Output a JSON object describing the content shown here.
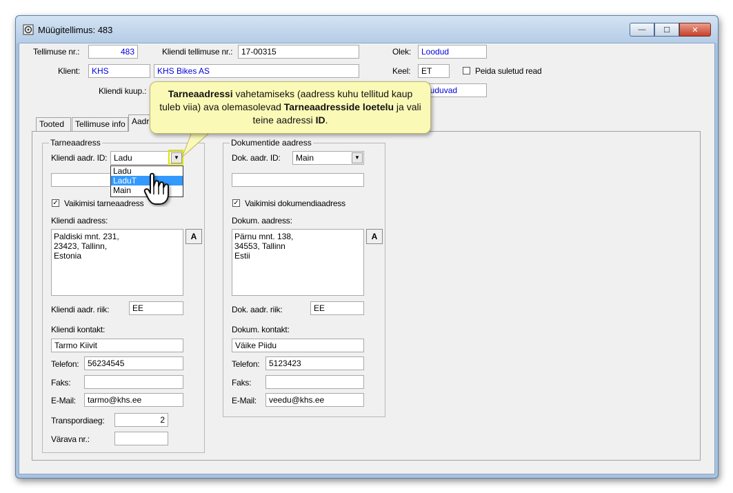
{
  "window": {
    "title": "Müügitellimus: 483"
  },
  "header": {
    "order_nr_label": "Tellimuse nr.:",
    "order_nr": "483",
    "client_order_label": "Kliendi tellimuse nr.:",
    "client_order": "17-00315",
    "state_label": "Olek:",
    "state": "Loodud",
    "client_label": "Klient:",
    "client_code": "KHS",
    "client_name": "KHS Bikes AS",
    "lang_label": "Keel:",
    "lang": "ET",
    "hide_closed_label": "Peida suletud read",
    "client_date_label": "Kliendi kuup.:",
    "status_value": "luduvad"
  },
  "tabs": [
    {
      "label": "Tooted"
    },
    {
      "label": "Tellimuse info"
    },
    {
      "label": "Aadr"
    }
  ],
  "tooltip": {
    "p1_bold": "Tarneaadressi",
    "p2": " vahetamiseks (aadress kuhu tellitud kaup tuleb viia) ava olemasolevad ",
    "p3_bold": "Tarneaadresside loetelu",
    "p4": " ja vali teine aadressi ",
    "p5_bold": "ID",
    "p6": "."
  },
  "delivery": {
    "group_title": "Tarneaadress",
    "addr_id_label": "Kliendi aadr. ID:",
    "addr_id": "Ladu",
    "options": [
      "Ladu",
      "LaduT",
      "Main"
    ],
    "selected_index": 1,
    "default_label": "Vaikimisi tarneaadress",
    "address_label": "Kliendi aadress:",
    "address": "Paldiski mnt. 231,\n23423, Tallinn,\nEstonia",
    "country_label": "Kliendi aadr. riik:",
    "country": "EE",
    "contact_label": "Kliendi kontakt:",
    "contact": "Tarmo Kiivit",
    "phone_label": "Telefon:",
    "phone": "56234545",
    "fax_label": "Faks:",
    "fax": "",
    "email_label": "E-Mail:",
    "email": "tarmo@khs.ee",
    "transport_label": "Transpordiaeg:",
    "transport": "2",
    "gate_label": "Värava nr.:",
    "gate": ""
  },
  "documents": {
    "group_title": "Dokumentide aadress",
    "addr_id_label": "Dok. aadr. ID:",
    "addr_id": "Main",
    "default_label": "Vaikimisi dokumendiaadress",
    "address_label": "Dokum. aadress:",
    "address": "Pärnu mnt. 138,\n34553, Tallinn\nEstii",
    "country_label": "Dok. aadr. riik:",
    "country": "EE",
    "contact_label": "Dokum. kontakt:",
    "contact": "Väike Piidu",
    "phone_label": "Telefon:",
    "phone": "5123423",
    "fax_label": "Faks:",
    "fax": "",
    "email_label": "E-Mail:",
    "email": "veedu@khs.ee"
  },
  "address_button_label": "A",
  "checkmark": "✓",
  "window_controls": {
    "minimize": "—",
    "maximize": "☐",
    "close": "✕"
  }
}
